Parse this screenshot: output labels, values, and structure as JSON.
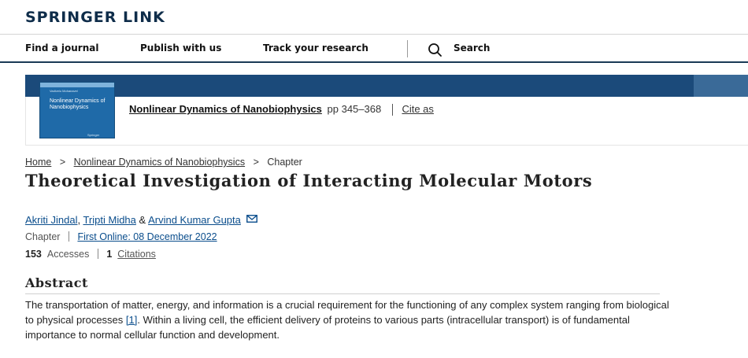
{
  "site": {
    "logo": "SPRINGER LINK"
  },
  "nav": {
    "items": [
      {
        "label": "Find a journal"
      },
      {
        "label": "Publish with us"
      },
      {
        "label": "Track your research"
      }
    ],
    "search_label": "Search"
  },
  "banner": {
    "cover": {
      "editors": "Vadivelu Mohanavel",
      "title": "Nonlinear Dynamics of Nanobiophysics",
      "publisher": "Springer"
    },
    "book_title": "Nonlinear Dynamics of Nanobiophysics",
    "pages": "pp 345–368",
    "cite_as": "Cite as"
  },
  "breadcrumb": {
    "home": "Home",
    "sep": ">",
    "book": "Nonlinear Dynamics of Nanobiophysics",
    "current": "Chapter"
  },
  "article": {
    "title": "Theoretical Investigation of Interacting Molecular Motors",
    "authors": [
      {
        "name": "Akriti Jindal",
        "after": ", "
      },
      {
        "name": "Tripti Midha",
        "after": " & "
      },
      {
        "name": "Arvind Kumar Gupta",
        "after": ""
      }
    ],
    "type": "Chapter",
    "first_online": "First Online: 08 December 2022",
    "accesses_count": "153",
    "accesses_label": "Accesses",
    "citations_count": "1",
    "citations_label": "Citations"
  },
  "abstract": {
    "heading": "Abstract",
    "text_before_ref": "The transportation of matter, energy, and information is a crucial requirement for the functioning of any complex system ranging from biological to physical processes ",
    "ref": "[1]",
    "text_after_ref": ". Within a living cell, the efficient delivery of proteins to various parts (intracellular transport) is of fundamental importance to normal cellular function and development."
  },
  "colors": {
    "brand_navy": "#0f2d4a",
    "banner_blue": "#1b4a7a",
    "link_blue": "#0a4d8c"
  }
}
